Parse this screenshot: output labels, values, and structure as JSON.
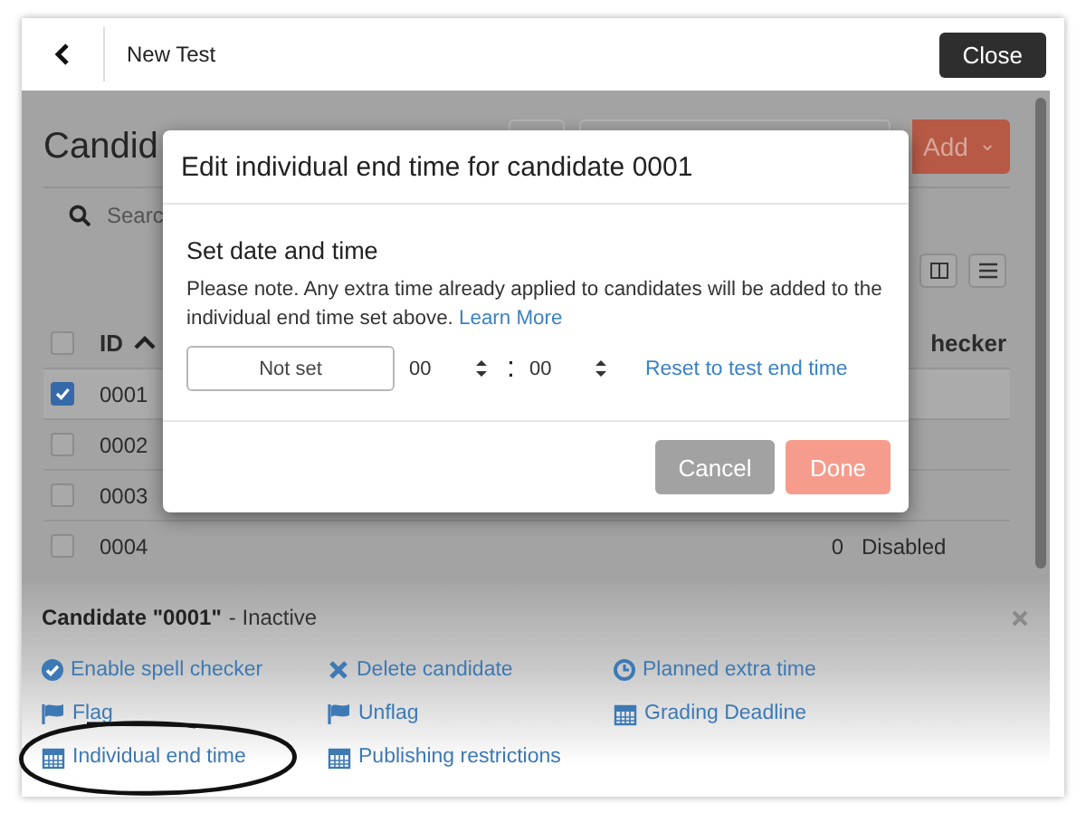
{
  "top_bar": {
    "title": "New Test",
    "close_button": "Close"
  },
  "page": {
    "heading": "Candid",
    "add_button": "Add",
    "search": {
      "placeholder": "Searc"
    },
    "columns": [
      "ID",
      "hecker"
    ],
    "all_checked": false,
    "rows": [
      {
        "id": "0001",
        "checked": true
      },
      {
        "id": "0002",
        "checked": false
      },
      {
        "id": "0003",
        "checked": false
      },
      {
        "id": "0004",
        "checked": false,
        "column_2": "0",
        "column_3": "Disabled"
      }
    ]
  },
  "dialog": {
    "title": "Edit individual end time for candidate 0001",
    "section_title": "Set date and time",
    "note": "Please note. Any extra time already applied to candidates will be added to the individual end time set above.",
    "learn_more": "Learn More",
    "date_field": {
      "placeholder": "Not set"
    },
    "hours": "00",
    "separator": ":",
    "minutes": "00",
    "reset_link": "Reset to test end time",
    "buttons": [
      {
        "label": "Cancel",
        "kind": "secondary"
      },
      {
        "label": "Done",
        "kind": "primary"
      }
    ]
  },
  "detail_panel": {
    "title": "Candidate \"0001\"",
    "status": "- Inactive",
    "actions": [
      {
        "label": "Enable spell checker",
        "kind": "check"
      },
      {
        "label": "Delete candidate",
        "kind": "cross"
      },
      {
        "label": "Planned extra time",
        "kind": "clock"
      },
      {
        "label": "Flag",
        "kind": "flag"
      },
      {
        "label": "Unflag",
        "kind": "flag"
      },
      {
        "label": "Grading Deadline",
        "kind": "calendar"
      },
      {
        "label": "Individual end time",
        "kind": "calendar"
      },
      {
        "label": "Publishing restrictions",
        "kind": "calendar"
      }
    ]
  }
}
